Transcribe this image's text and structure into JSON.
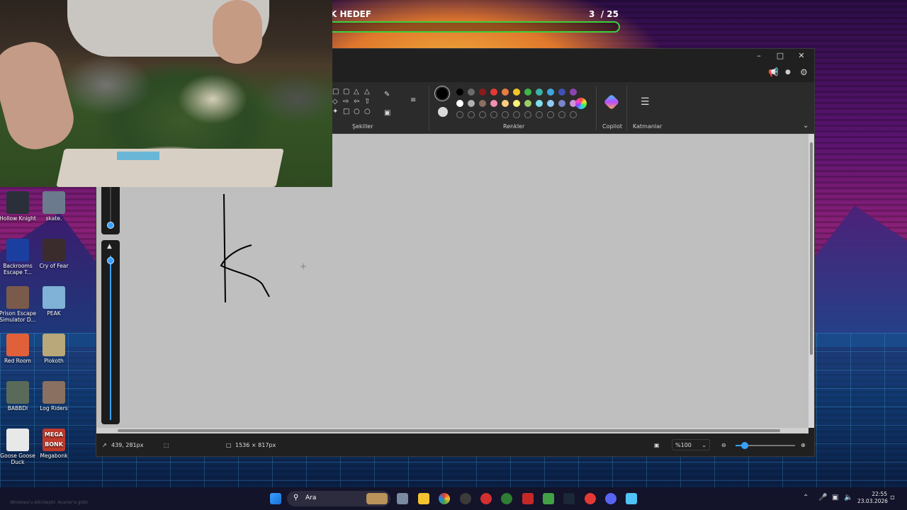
{
  "goal": {
    "title": "ABONELİK HEDEF",
    "current": "3",
    "total": "/ 25",
    "progress": 0.12
  },
  "paint": {
    "ribbon": {
      "groups": {
        "shapes": "Şekiller",
        "colors": "Renkler",
        "copilot": "Copilot",
        "layers": "Katmanlar"
      },
      "palette_row1": [
        "#000000",
        "#6b6b6b",
        "#8b1a1a",
        "#e53935",
        "#e87d3e",
        "#f3c623",
        "#3fb54a",
        "#3bb3a6",
        "#3da5e0",
        "#3f51b5",
        "#8e44ad"
      ],
      "palette_row2": [
        "#ffffff",
        "#b0b0b0",
        "#8d6e63",
        "#f48fb1",
        "#ffcc80",
        "#fff176",
        "#9ccc65",
        "#80deea",
        "#90caf9",
        "#7986cb",
        "#ce93d8"
      ],
      "icons": [
        "rectangle-icon",
        "triangle-icon",
        "arrow-icon",
        "star-icon",
        "speech-bubble-icon",
        "heart-icon",
        "brush-icon",
        "fill-icon",
        "copilot-icon",
        "layers-icon",
        "settings-icon",
        "share-icon"
      ]
    },
    "status": {
      "cursor": "439, 281px",
      "size": "1536 × 817px",
      "zoom": "%100"
    }
  },
  "desktop_icons": [
    {
      "label": "Hollow Knight",
      "color": "#2a2f3a"
    },
    {
      "label": "skate.",
      "color": "#6b7b8d"
    },
    {
      "label": "Backrooms Escape T...",
      "color": "#1b3fa0"
    },
    {
      "label": "Cry of Fear",
      "color": "#3a2c2c"
    },
    {
      "label": "Prison Escape Simulator D...",
      "color": "#7a5a4a"
    },
    {
      "label": "PEAK",
      "color": "#7fb2d6"
    },
    {
      "label": "Red Room",
      "color": "#e0603a"
    },
    {
      "label": "Plokoth",
      "color": "#b8a87a"
    },
    {
      "label": "BABBDI",
      "color": "#5a6a5a"
    },
    {
      "label": "Log Riders",
      "color": "#8a7060"
    },
    {
      "label": "Goose Goose Duck",
      "color": "#e8e8e8"
    },
    {
      "label": "Megabonk",
      "color": "#c0392b"
    }
  ],
  "megabonk_text": "MEGA BONK",
  "taskbar": {
    "search_label": "Ara",
    "time": "22:55",
    "date": "23.03.2026",
    "ghost_text": "Windows'u etkinleştir. Ayarlar'a gidin"
  }
}
